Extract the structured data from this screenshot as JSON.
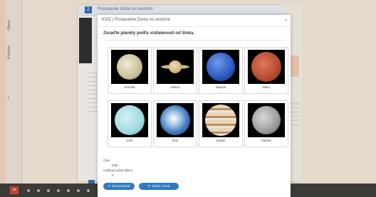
{
  "background": {
    "side_tabs": [
      "Obsah",
      "Knižnice"
    ],
    "book_page_number": "2",
    "book_header": "Postavenie Zeme vo vesmíre",
    "bottom_button": "≡"
  },
  "modal": {
    "title": "KVIZ | Postavenie Zeme vo vesmíre",
    "close_glyph": "×",
    "question": "Zoraďte planéty podľa vzdialenosti od Slnka.",
    "cards": [
      {
        "label": "Venuša"
      },
      {
        "label": "Saturn"
      },
      {
        "label": "Neptún"
      },
      {
        "label": "Mars"
      },
      {
        "label": "Urán"
      },
      {
        "label": "Zem"
      },
      {
        "label": "Jupiter"
      },
      {
        "label": "Merkúr"
      }
    ],
    "results": {
      "time_label": "Čas:",
      "time_value": "0:00",
      "attempts_label": "Celkový počet ťahov:",
      "attempts_value": "0"
    },
    "buttons": {
      "check": "Skontrolovať",
      "restart": "Začať znova"
    }
  }
}
